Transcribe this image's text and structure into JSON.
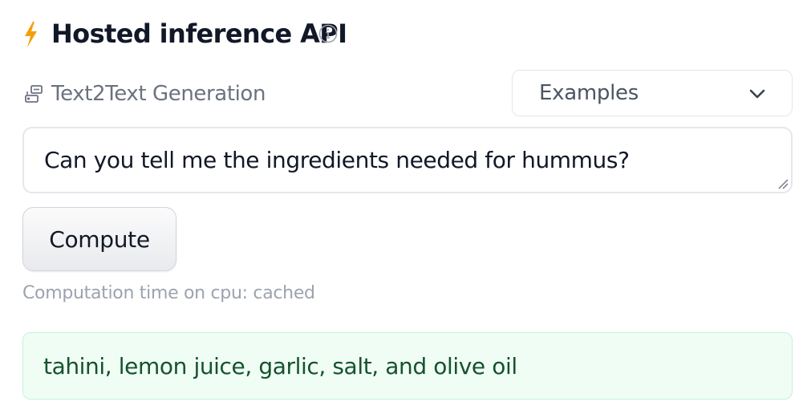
{
  "header": {
    "title": "Hosted inference API",
    "icon": "lightning-bolt-icon",
    "info_icon": "info-circle-icon",
    "accent_color": "#f59e0b"
  },
  "task": {
    "label": "Text2Text Generation",
    "icon": "text2text-generation-icon"
  },
  "examples_dropdown": {
    "label": "Examples",
    "icon": "chevron-down-icon"
  },
  "input": {
    "value": "Can you tell me the ingredients needed for hummus?"
  },
  "compute_button": {
    "label": "Compute"
  },
  "status": {
    "computation_time": "Computation time on cpu: cached"
  },
  "output": {
    "text": "tahini, lemon juice, garlic, salt, and olive oil",
    "background_color": "#f0fdf4",
    "text_color": "#14532d"
  }
}
